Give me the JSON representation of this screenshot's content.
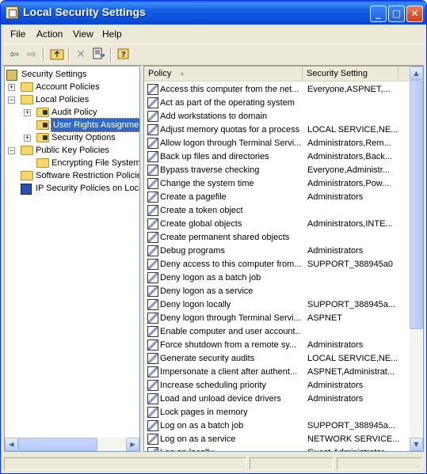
{
  "window": {
    "title": "Local Security Settings",
    "minimize": "_",
    "maximize": "□",
    "close": "✕"
  },
  "menu": [
    "File",
    "Action",
    "View",
    "Help"
  ],
  "toolbar": [
    "back-icon",
    "forward-icon",
    "up-folder-icon",
    "delete-icon",
    "export-icon",
    "help-icon"
  ],
  "tree": [
    {
      "label": "Security Settings",
      "indent": 0,
      "expander": "",
      "icon": "computer"
    },
    {
      "label": "Account Policies",
      "indent": 1,
      "expander": "+",
      "icon": "folder"
    },
    {
      "label": "Local Policies",
      "indent": 1,
      "expander": "−",
      "icon": "folder"
    },
    {
      "label": "Audit Policy",
      "indent": 2,
      "expander": "+",
      "icon": "lockfolder"
    },
    {
      "label": "User Rights Assignment",
      "indent": 2,
      "expander": "",
      "icon": "lockfolder",
      "selected": true
    },
    {
      "label": "Security Options",
      "indent": 2,
      "expander": "+",
      "icon": "lockfolder"
    },
    {
      "label": "Public Key Policies",
      "indent": 1,
      "expander": "−",
      "icon": "folder"
    },
    {
      "label": "Encrypting File System",
      "indent": 2,
      "expander": "",
      "icon": "folder"
    },
    {
      "label": "Software Restriction Policies",
      "indent": 1,
      "expander": "",
      "icon": "folder"
    },
    {
      "label": "IP Security Policies on Local Computer",
      "indent": 1,
      "expander": "",
      "icon": "ip"
    }
  ],
  "columns": {
    "policy": "Policy",
    "setting": "Security Setting"
  },
  "rows": [
    {
      "policy": "Access this computer from the net...",
      "setting": "Everyone,ASPNET,..."
    },
    {
      "policy": "Act as part of the operating system",
      "setting": ""
    },
    {
      "policy": "Add workstations to domain",
      "setting": ""
    },
    {
      "policy": "Adjust memory quotas for a process",
      "setting": "LOCAL SERVICE,NE..."
    },
    {
      "policy": "Allow logon through Terminal Servi...",
      "setting": "Administrators,Rem..."
    },
    {
      "policy": "Back up files and directories",
      "setting": "Administrators,Back..."
    },
    {
      "policy": "Bypass traverse checking",
      "setting": "Everyone,Administr..."
    },
    {
      "policy": "Change the system time",
      "setting": "Administrators,Pow..."
    },
    {
      "policy": "Create a pagefile",
      "setting": "Administrators"
    },
    {
      "policy": "Create a token object",
      "setting": ""
    },
    {
      "policy": "Create global objects",
      "setting": "Administrators,INTE..."
    },
    {
      "policy": "Create permanent shared objects",
      "setting": ""
    },
    {
      "policy": "Debug programs",
      "setting": "Administrators"
    },
    {
      "policy": "Deny access to this computer from...",
      "setting": "SUPPORT_388945a0"
    },
    {
      "policy": "Deny logon as a batch job",
      "setting": ""
    },
    {
      "policy": "Deny logon as a service",
      "setting": ""
    },
    {
      "policy": "Deny logon locally",
      "setting": "SUPPORT_388945a..."
    },
    {
      "policy": "Deny logon through Terminal Servi...",
      "setting": "ASPNET"
    },
    {
      "policy": "Enable computer and user account...",
      "setting": ""
    },
    {
      "policy": "Force shutdown from a remote sy...",
      "setting": "Administrators"
    },
    {
      "policy": "Generate security audits",
      "setting": "LOCAL SERVICE,NE..."
    },
    {
      "policy": "Impersonate a client after authent...",
      "setting": "ASPNET,Administrat..."
    },
    {
      "policy": "Increase scheduling priority",
      "setting": "Administrators"
    },
    {
      "policy": "Load and unload device drivers",
      "setting": "Administrators"
    },
    {
      "policy": "Lock pages in memory",
      "setting": ""
    },
    {
      "policy": "Log on as a batch job",
      "setting": "SUPPORT_388945a..."
    },
    {
      "policy": "Log on as a service",
      "setting": "NETWORK SERVICE..."
    },
    {
      "policy": "Log on locally",
      "setting": "Guest,Administrator..."
    }
  ],
  "status": [
    "",
    "",
    ""
  ]
}
